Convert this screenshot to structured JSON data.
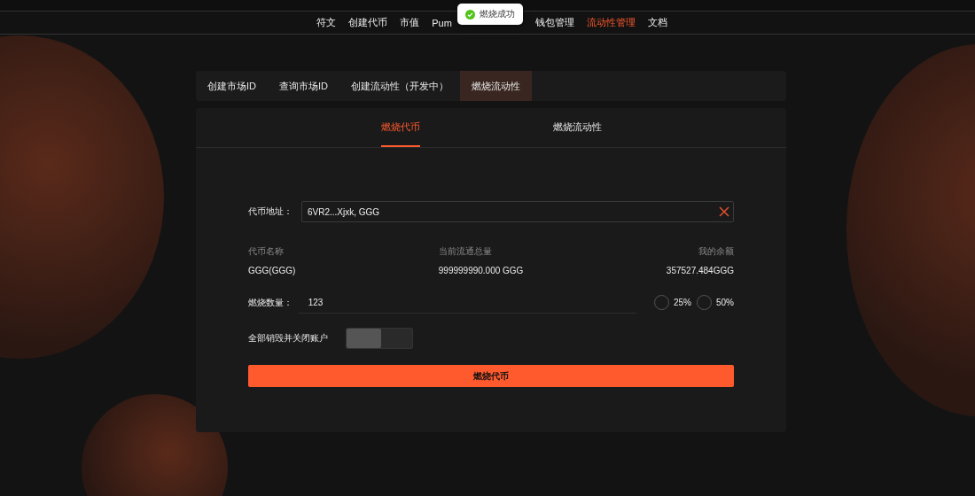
{
  "nav": {
    "items": [
      {
        "label": "符文",
        "selected": false
      },
      {
        "label": "创建代币",
        "selected": false
      },
      {
        "label": "市值",
        "selected": false
      },
      {
        "label": "Pum",
        "selected": false
      },
      {
        "label": "钱包管理",
        "selected": false
      },
      {
        "label": "流动性管理",
        "selected": true
      },
      {
        "label": "文档",
        "selected": false
      }
    ]
  },
  "toast": {
    "text": "燃烧成功",
    "kind": "success"
  },
  "tabs": [
    {
      "label": "创建市场ID",
      "selected": false
    },
    {
      "label": "查询市场ID",
      "selected": false
    },
    {
      "label": "创建流动性（开发中）",
      "selected": false
    },
    {
      "label": "燃烧流动性",
      "selected": true
    }
  ],
  "subtabs": [
    {
      "label": "燃烧代币",
      "selected": true
    },
    {
      "label": "燃烧流动性",
      "selected": false
    }
  ],
  "form": {
    "address_label": "代币地址：",
    "address_value": "6VR2...Xjxk, GGG",
    "info": [
      {
        "label": "代币名称",
        "value": "GGG(GGG)"
      },
      {
        "label": "当前流通总量",
        "value": "999999990.000 GGG"
      },
      {
        "label": "我的余额",
        "value": "357527.484GGG"
      }
    ],
    "amount_label": "燃烧数量：",
    "amount_value": "123",
    "presets": [
      {
        "label": "25%",
        "selected": false
      },
      {
        "label": "50%",
        "selected": false
      }
    ],
    "close_label": "全部销毁并关闭账户",
    "close_on": false,
    "submit": "燃烧代币"
  }
}
